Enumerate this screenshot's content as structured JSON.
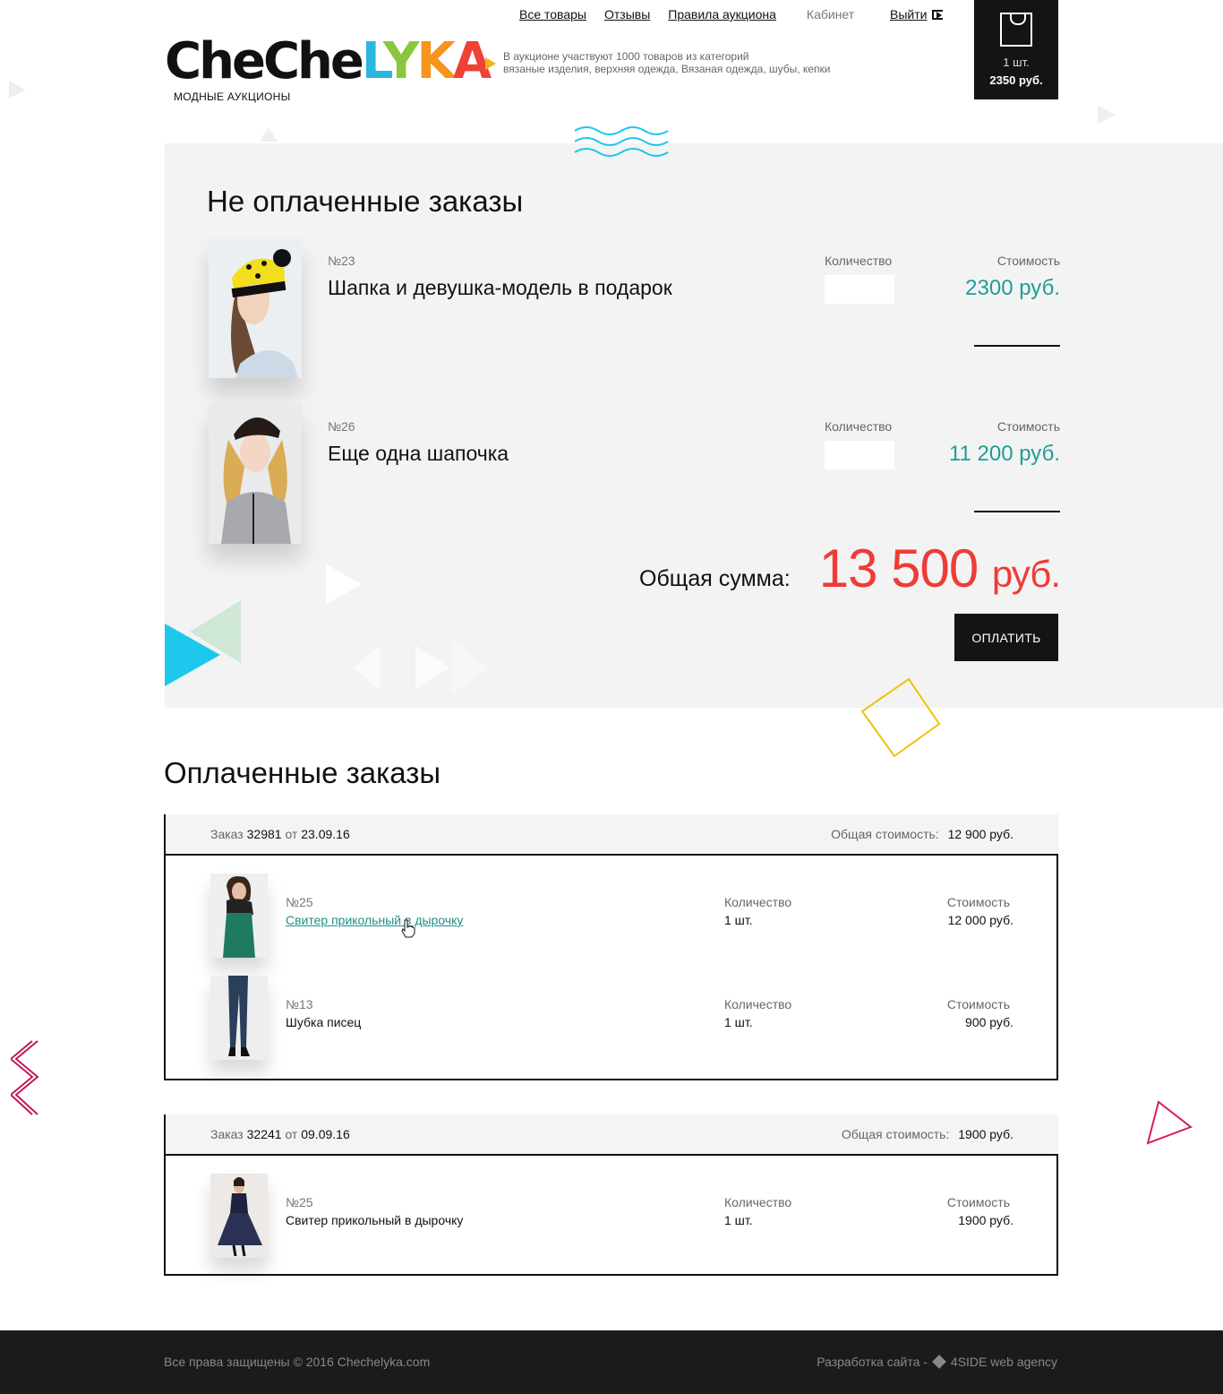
{
  "header": {
    "logo_parts": {
      "che1": "Che",
      "che2": "Che",
      "l": "L",
      "y": "Y",
      "k": "K",
      "a": "A"
    },
    "logo_subtitle": "МОДНЫЕ АУКЦИОНЫ",
    "tagline_line1": "В аукционе участвуют 1000 товаров из категорий",
    "tagline_line2": "вязаные изделия, верхняя одежда, Вязаная одежда, шубы, кепки",
    "nav": {
      "all_goods": "Все товары",
      "reviews": "Отзывы",
      "rules": "Правила аукциона",
      "cabinet": "Кабинет",
      "logout": "Выйти"
    },
    "cart": {
      "qty": "1 шт.",
      "sum": "2350 руб."
    }
  },
  "unpaid": {
    "title": "Не оплаченные заказы",
    "items": [
      {
        "num": "№23",
        "name": "Шапка и девушка-модель в подарок",
        "qty_label": "Количество",
        "qty_value": "",
        "price_label": "Стоимость",
        "price": "2300 руб."
      },
      {
        "num": "№26",
        "name": "Еще одна шапочка",
        "qty_label": "Количество",
        "qty_value": "",
        "price_label": "Стоимость",
        "price": "11 200 руб."
      }
    ],
    "total_label": "Общая сумма:",
    "total_value": "13 500",
    "total_currency": "руб.",
    "pay_button": "ОПЛАТИТЬ"
  },
  "paid": {
    "title": "Оплаченные заказы",
    "orders": [
      {
        "order_word": "Заказ",
        "order_num": "32981",
        "from_word": "от",
        "date": "23.09.16",
        "total_label": "Общая стоимость:",
        "total": "12 900 руб.",
        "items": [
          {
            "num": "№25",
            "name": "Свитер прикольный в дырочку",
            "qty_label": "Количество",
            "qty": "1 шт.",
            "price_label": "Стоимость",
            "price": "12 000 руб."
          },
          {
            "num": "№13",
            "name": "Шубка писец",
            "qty_label": "Количество",
            "qty": "1 шт.",
            "price_label": "Стоимость",
            "price": "900 руб."
          }
        ]
      },
      {
        "order_word": "Заказ",
        "order_num": "32241",
        "from_word": "от",
        "date": "09.09.16",
        "total_label": "Общая стоимость:",
        "total": "1900 руб.",
        "items": [
          {
            "num": "№25",
            "name": "Свитер прикольный в дырочку",
            "qty_label": "Количество",
            "qty": "1 шт.",
            "price_label": "Стоимость",
            "price": "1900 руб."
          }
        ]
      }
    ]
  },
  "footer": {
    "copyright": "Все права защищены © 2016 Chechelyka.com",
    "dev_label": "Разработка сайта -",
    "agency": "4SIDE web agency"
  },
  "colors": {
    "accent_teal": "#1f9e94",
    "total_red": "#ef3b36",
    "dark": "#141414",
    "logo_yellow_arrow": "#f5b21a"
  }
}
